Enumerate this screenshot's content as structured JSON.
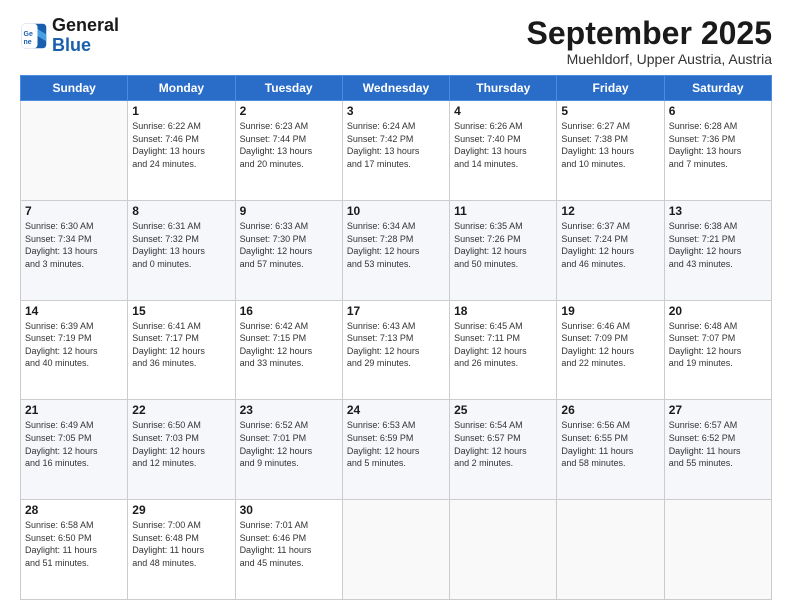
{
  "header": {
    "logo_general": "General",
    "logo_blue": "Blue",
    "month_title": "September 2025",
    "subtitle": "Muehldorf, Upper Austria, Austria"
  },
  "weekdays": [
    "Sunday",
    "Monday",
    "Tuesday",
    "Wednesday",
    "Thursday",
    "Friday",
    "Saturday"
  ],
  "rows": [
    [
      {
        "day": "",
        "info": ""
      },
      {
        "day": "1",
        "info": "Sunrise: 6:22 AM\nSunset: 7:46 PM\nDaylight: 13 hours\nand 24 minutes."
      },
      {
        "day": "2",
        "info": "Sunrise: 6:23 AM\nSunset: 7:44 PM\nDaylight: 13 hours\nand 20 minutes."
      },
      {
        "day": "3",
        "info": "Sunrise: 6:24 AM\nSunset: 7:42 PM\nDaylight: 13 hours\nand 17 minutes."
      },
      {
        "day": "4",
        "info": "Sunrise: 6:26 AM\nSunset: 7:40 PM\nDaylight: 13 hours\nand 14 minutes."
      },
      {
        "day": "5",
        "info": "Sunrise: 6:27 AM\nSunset: 7:38 PM\nDaylight: 13 hours\nand 10 minutes."
      },
      {
        "day": "6",
        "info": "Sunrise: 6:28 AM\nSunset: 7:36 PM\nDaylight: 13 hours\nand 7 minutes."
      }
    ],
    [
      {
        "day": "7",
        "info": "Sunrise: 6:30 AM\nSunset: 7:34 PM\nDaylight: 13 hours\nand 3 minutes."
      },
      {
        "day": "8",
        "info": "Sunrise: 6:31 AM\nSunset: 7:32 PM\nDaylight: 13 hours\nand 0 minutes."
      },
      {
        "day": "9",
        "info": "Sunrise: 6:33 AM\nSunset: 7:30 PM\nDaylight: 12 hours\nand 57 minutes."
      },
      {
        "day": "10",
        "info": "Sunrise: 6:34 AM\nSunset: 7:28 PM\nDaylight: 12 hours\nand 53 minutes."
      },
      {
        "day": "11",
        "info": "Sunrise: 6:35 AM\nSunset: 7:26 PM\nDaylight: 12 hours\nand 50 minutes."
      },
      {
        "day": "12",
        "info": "Sunrise: 6:37 AM\nSunset: 7:24 PM\nDaylight: 12 hours\nand 46 minutes."
      },
      {
        "day": "13",
        "info": "Sunrise: 6:38 AM\nSunset: 7:21 PM\nDaylight: 12 hours\nand 43 minutes."
      }
    ],
    [
      {
        "day": "14",
        "info": "Sunrise: 6:39 AM\nSunset: 7:19 PM\nDaylight: 12 hours\nand 40 minutes."
      },
      {
        "day": "15",
        "info": "Sunrise: 6:41 AM\nSunset: 7:17 PM\nDaylight: 12 hours\nand 36 minutes."
      },
      {
        "day": "16",
        "info": "Sunrise: 6:42 AM\nSunset: 7:15 PM\nDaylight: 12 hours\nand 33 minutes."
      },
      {
        "day": "17",
        "info": "Sunrise: 6:43 AM\nSunset: 7:13 PM\nDaylight: 12 hours\nand 29 minutes."
      },
      {
        "day": "18",
        "info": "Sunrise: 6:45 AM\nSunset: 7:11 PM\nDaylight: 12 hours\nand 26 minutes."
      },
      {
        "day": "19",
        "info": "Sunrise: 6:46 AM\nSunset: 7:09 PM\nDaylight: 12 hours\nand 22 minutes."
      },
      {
        "day": "20",
        "info": "Sunrise: 6:48 AM\nSunset: 7:07 PM\nDaylight: 12 hours\nand 19 minutes."
      }
    ],
    [
      {
        "day": "21",
        "info": "Sunrise: 6:49 AM\nSunset: 7:05 PM\nDaylight: 12 hours\nand 16 minutes."
      },
      {
        "day": "22",
        "info": "Sunrise: 6:50 AM\nSunset: 7:03 PM\nDaylight: 12 hours\nand 12 minutes."
      },
      {
        "day": "23",
        "info": "Sunrise: 6:52 AM\nSunset: 7:01 PM\nDaylight: 12 hours\nand 9 minutes."
      },
      {
        "day": "24",
        "info": "Sunrise: 6:53 AM\nSunset: 6:59 PM\nDaylight: 12 hours\nand 5 minutes."
      },
      {
        "day": "25",
        "info": "Sunrise: 6:54 AM\nSunset: 6:57 PM\nDaylight: 12 hours\nand 2 minutes."
      },
      {
        "day": "26",
        "info": "Sunrise: 6:56 AM\nSunset: 6:55 PM\nDaylight: 11 hours\nand 58 minutes."
      },
      {
        "day": "27",
        "info": "Sunrise: 6:57 AM\nSunset: 6:52 PM\nDaylight: 11 hours\nand 55 minutes."
      }
    ],
    [
      {
        "day": "28",
        "info": "Sunrise: 6:58 AM\nSunset: 6:50 PM\nDaylight: 11 hours\nand 51 minutes."
      },
      {
        "day": "29",
        "info": "Sunrise: 7:00 AM\nSunset: 6:48 PM\nDaylight: 11 hours\nand 48 minutes."
      },
      {
        "day": "30",
        "info": "Sunrise: 7:01 AM\nSunset: 6:46 PM\nDaylight: 11 hours\nand 45 minutes."
      },
      {
        "day": "",
        "info": ""
      },
      {
        "day": "",
        "info": ""
      },
      {
        "day": "",
        "info": ""
      },
      {
        "day": "",
        "info": ""
      }
    ]
  ]
}
